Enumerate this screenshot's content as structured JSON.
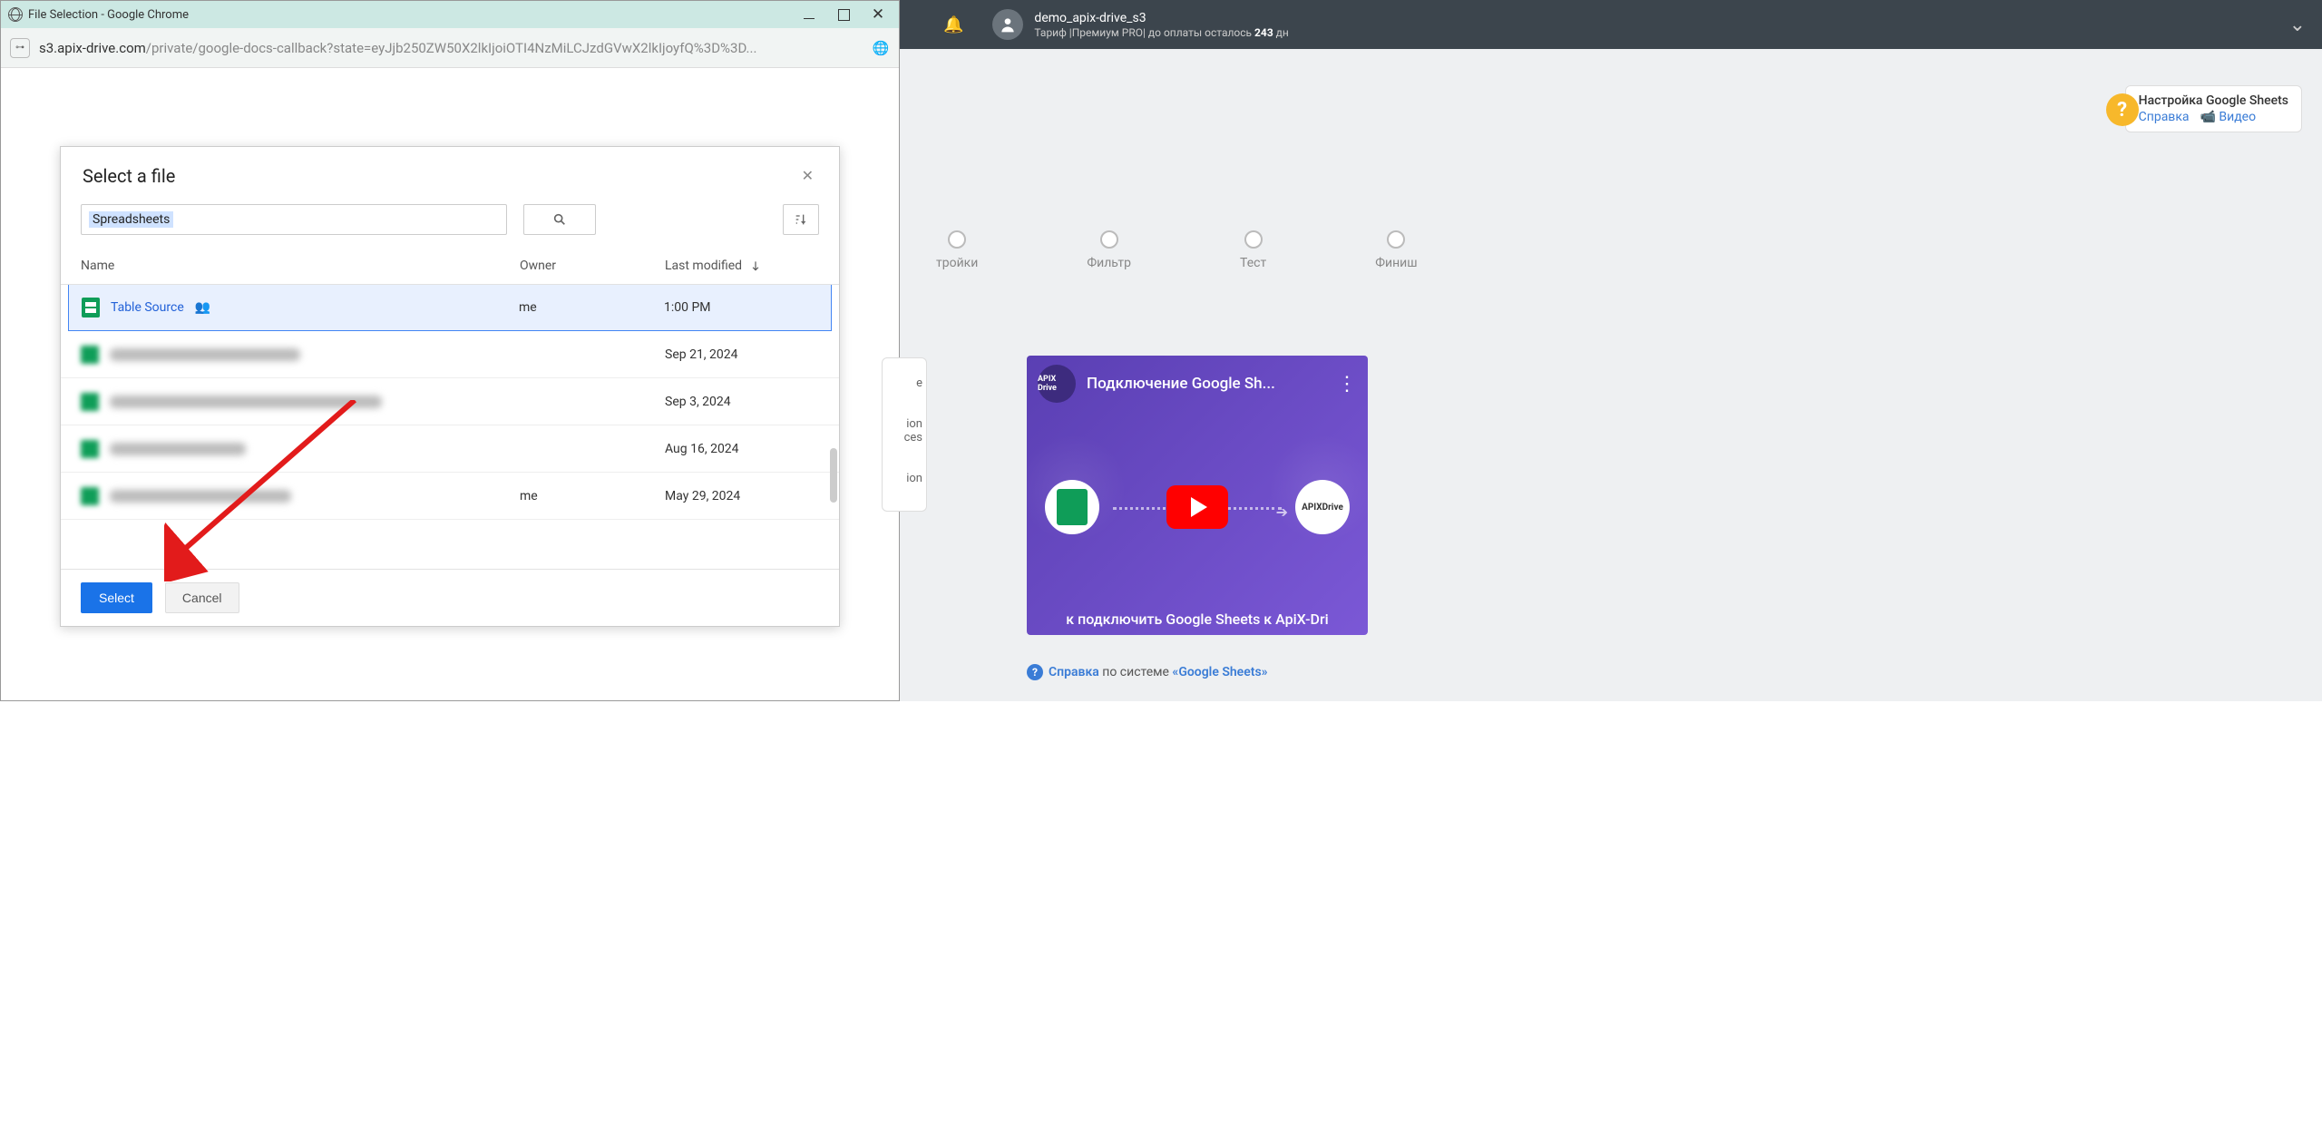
{
  "popup": {
    "window_title": "File Selection - Google Chrome",
    "url_dark": "s3.apix-drive.com",
    "url_rest": "/private/google-docs-callback?state=eyJjb250ZW50X2lkIjoiOTI4NzMiLCJzdGVwX2lkIjoyfQ%3D%3D..."
  },
  "picker": {
    "title": "Select a file",
    "search_term": "Spreadsheets",
    "columns": {
      "name": "Name",
      "owner": "Owner",
      "modified": "Last modified"
    },
    "rows": [
      {
        "name": "Table Source",
        "owner": "me",
        "modified": "1:00 PM",
        "selected": true,
        "shared": true
      },
      {
        "name": "",
        "owner": "",
        "modified": "Sep 21, 2024",
        "blurred": true,
        "namew": 210
      },
      {
        "name": "",
        "owner": "",
        "modified": "Sep 3, 2024",
        "blurred": true,
        "namew": 300
      },
      {
        "name": "",
        "owner": "",
        "modified": "Aug 16, 2024",
        "blurred": true,
        "namew": 150
      },
      {
        "name": "",
        "owner": "me",
        "modified": "May 29, 2024",
        "blurred": true,
        "namew": 200
      }
    ],
    "buttons": {
      "select": "Select",
      "cancel": "Cancel"
    }
  },
  "apix": {
    "username": "demo_apix-drive_s3",
    "tariff_line": "Тариф |Премиум PRO| до оплаты осталось ",
    "tariff_days": "243",
    "tariff_suffix": " дн",
    "help": {
      "title": "Настройка Google Sheets",
      "link1": "Справка",
      "link2": "Видео"
    },
    "steps": [
      "тройки",
      "Фильтр",
      "Тест",
      "Финиш"
    ],
    "fragments": [
      "e",
      "ion ces",
      "ion"
    ],
    "video": {
      "title": "Подключение Google Sh...",
      "footer": "к подключить Google Sheets к ApiX-Dri",
      "logo": "APIX Drive",
      "right_label": "APIXDrive"
    },
    "reference": {
      "prefix": "Справка",
      "mid": " по системе ",
      "system": "«Google Sheets»"
    }
  }
}
